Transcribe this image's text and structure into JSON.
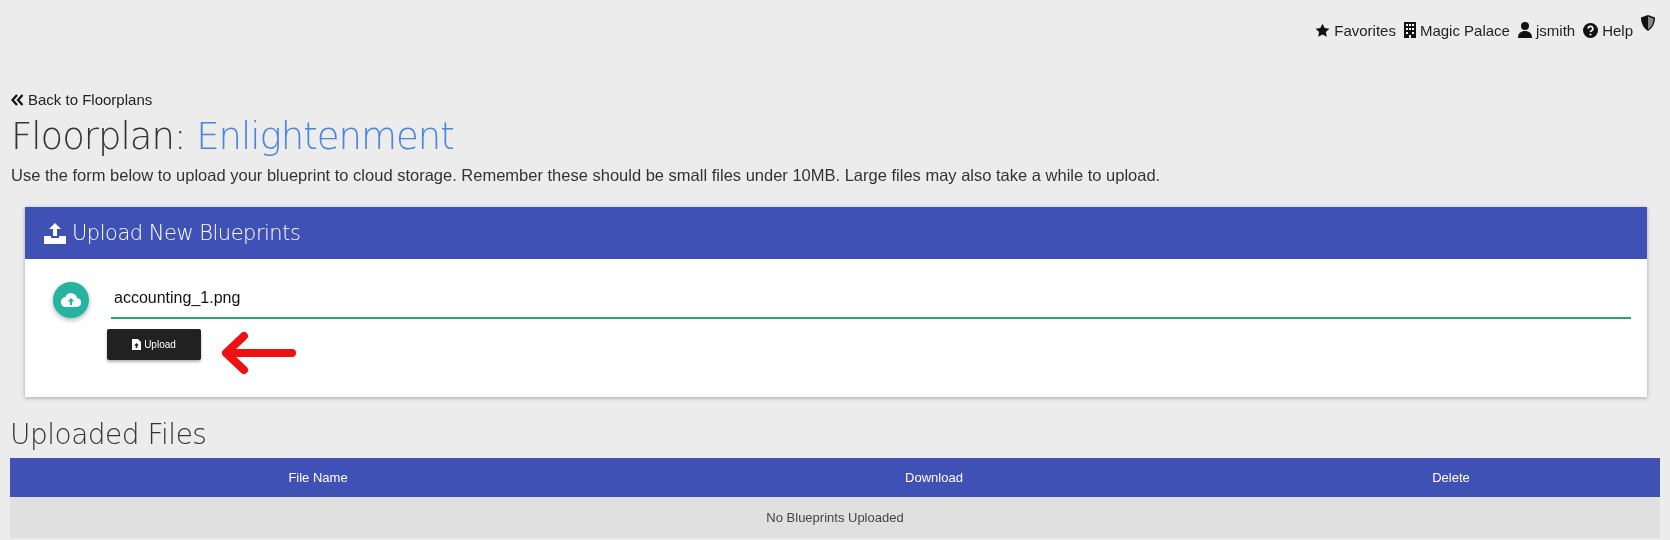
{
  "top_nav": {
    "items": [
      {
        "kind": "favorites",
        "label": "Favorites"
      },
      {
        "kind": "building",
        "label": "Magic Palace"
      },
      {
        "kind": "user",
        "label": "jsmith"
      },
      {
        "kind": "help",
        "label": "Help"
      }
    ]
  },
  "back_link": "Back to Floorplans",
  "heading": {
    "prefix": "Floorplan:",
    "name": "Enlightenment"
  },
  "description": "Use the form below to upload your blueprint to cloud storage. Remember these should be small files under 10MB. Large files may also take a while to upload.",
  "upload_card": {
    "title": "Upload New Blueprints",
    "file_value": "accounting_1.png",
    "button": "Upload"
  },
  "files_section": {
    "title": "Uploaded Files",
    "table": {
      "columns": [
        "File Name",
        "Download",
        "Delete"
      ],
      "empty_message": "No Blueprints Uploaded"
    }
  }
}
